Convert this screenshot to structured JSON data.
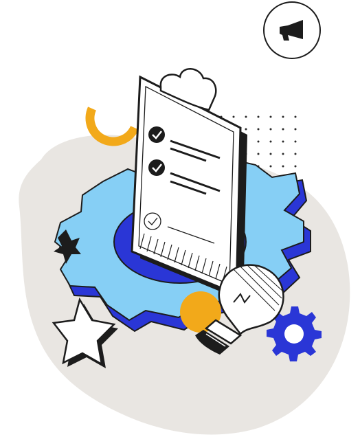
{
  "illustration": {
    "subject": "task-checklist-with-gear-and-lightbulb",
    "checklist_items": [
      {
        "state": "checked"
      },
      {
        "state": "checked"
      },
      {
        "state": "pending"
      }
    ],
    "icons": [
      "megaphone-icon",
      "clipboard-icon",
      "gear-icon",
      "lightbulb-icon",
      "star-icon",
      "check-icon"
    ]
  },
  "colors": {
    "blob": "#e9e6e2",
    "gear_light": "#86cff5",
    "gear_dark": "#2a36d6",
    "accent_orange": "#f2a91a",
    "ink": "#1c1c1c",
    "paper": "#ffffff"
  }
}
